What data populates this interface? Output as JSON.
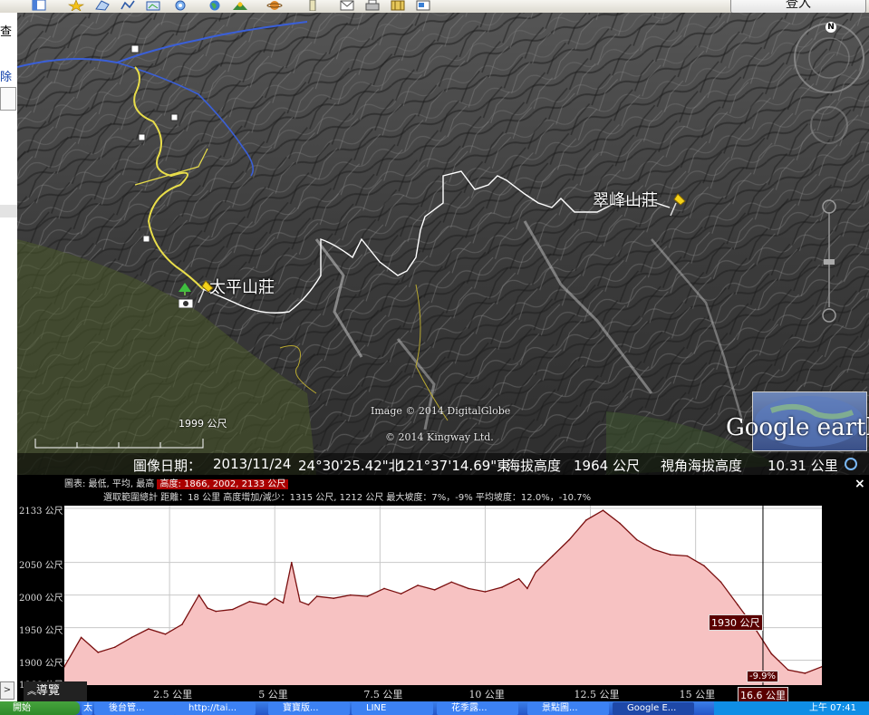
{
  "toolbar": {
    "signin_label": "登入",
    "icons": [
      "sidebar-icon",
      "star-icon",
      "polygon-icon",
      "path-icon",
      "overlay-icon",
      "tour-icon",
      "earth-icon",
      "sun-icon",
      "planet-icon",
      "ruler-icon",
      "email-icon",
      "print-icon",
      "map-icon",
      "kml-icon"
    ]
  },
  "left_panel": {
    "label_a": "查",
    "label_b": "除"
  },
  "map": {
    "places": [
      {
        "label": "太平山莊"
      },
      {
        "label": "翠峰山莊"
      }
    ],
    "scale_label": "1999 公尺",
    "image_credit": "Image © 2014 DigitalGlobe",
    "data_credit": "© 2014 Kingway Ltd.",
    "logo_text": "Google earth",
    "compass_north": "N"
  },
  "status_bar": {
    "image_date_label": "圖像日期：",
    "image_date": "2013/11/24",
    "latitude": "24°30'25.42\"北",
    "longitude": "121°37'14.69\"東",
    "elevation_label": "海拔高度",
    "elevation": "1964 公尺",
    "eye_alt_label": "視角海拔高度",
    "eye_alt": "10.31 公里"
  },
  "elevation_profile": {
    "header_prefix": "圖表: 最低, 平均, 最高",
    "header_highlight": "高度: 1866, 2002, 2133 公尺",
    "range_summary": "選取範圍總計 距離：18 公里 高度增加/減少：1315 公尺, 1212 公尺 最大坡度：7%，-9% 平均坡度：12.0%，-10.7%",
    "close_label": "×",
    "tour_button": "導覽",
    "cursor_elevation": "1930 公尺",
    "cursor_slope": "-9.9%",
    "cursor_distance": "16.6 公里"
  },
  "chart_data": {
    "type": "area",
    "xlabel": "",
    "ylabel": "",
    "xlim": [
      0,
      18
    ],
    "ylim": [
      1866,
      2133
    ],
    "y_ticks": [
      "2133 公尺",
      "2050 公尺",
      "2000 公尺",
      "1950 公尺",
      "1900 公尺",
      "1866 公尺"
    ],
    "y_tick_values": [
      2133,
      2050,
      2000,
      1950,
      1900,
      1866
    ],
    "x_ticks": [
      "2.5 公里",
      "5 公里",
      "7.5 公里",
      "10 公里",
      "12.5 公里",
      "15 公里"
    ],
    "x_tick_values": [
      2.5,
      5,
      7.5,
      10,
      12.5,
      15
    ],
    "x": [
      0,
      0.4,
      0.8,
      1.2,
      1.6,
      2.0,
      2.4,
      2.8,
      3.2,
      3.4,
      3.6,
      4.0,
      4.4,
      4.8,
      5.0,
      5.2,
      5.4,
      5.6,
      5.8,
      6.0,
      6.4,
      6.8,
      7.2,
      7.6,
      8.0,
      8.4,
      8.8,
      9.2,
      9.6,
      10.0,
      10.4,
      10.8,
      11.0,
      11.2,
      11.6,
      12.0,
      12.4,
      12.8,
      13.2,
      13.6,
      14.0,
      14.4,
      14.8,
      15.2,
      15.6,
      16.0,
      16.4,
      16.6,
      16.8,
      17.2,
      17.6,
      18.0
    ],
    "y": [
      1890,
      1935,
      1912,
      1920,
      1935,
      1948,
      1940,
      1955,
      2000,
      1980,
      1975,
      1978,
      1990,
      1985,
      1995,
      1988,
      2050,
      1990,
      1985,
      1998,
      1995,
      2000,
      1998,
      2010,
      2002,
      2015,
      2008,
      2020,
      2010,
      2005,
      2012,
      2025,
      2010,
      2035,
      2060,
      2085,
      2115,
      2130,
      2110,
      2085,
      2070,
      2062,
      2060,
      2045,
      2020,
      1985,
      1950,
      1930,
      1910,
      1885,
      1880,
      1890
    ],
    "cursor_x": 16.6,
    "cursor_y": 1930,
    "series": [
      {
        "values": "y"
      }
    ]
  },
  "taskbar": {
    "start_label": "開始",
    "tasks": [
      "太平山...",
      "後台管...",
      "http://tai...",
      "寶寶版...",
      "LINE",
      "花季露...",
      "景點圖...",
      "Google E..."
    ],
    "clock": "上午 07:41"
  }
}
